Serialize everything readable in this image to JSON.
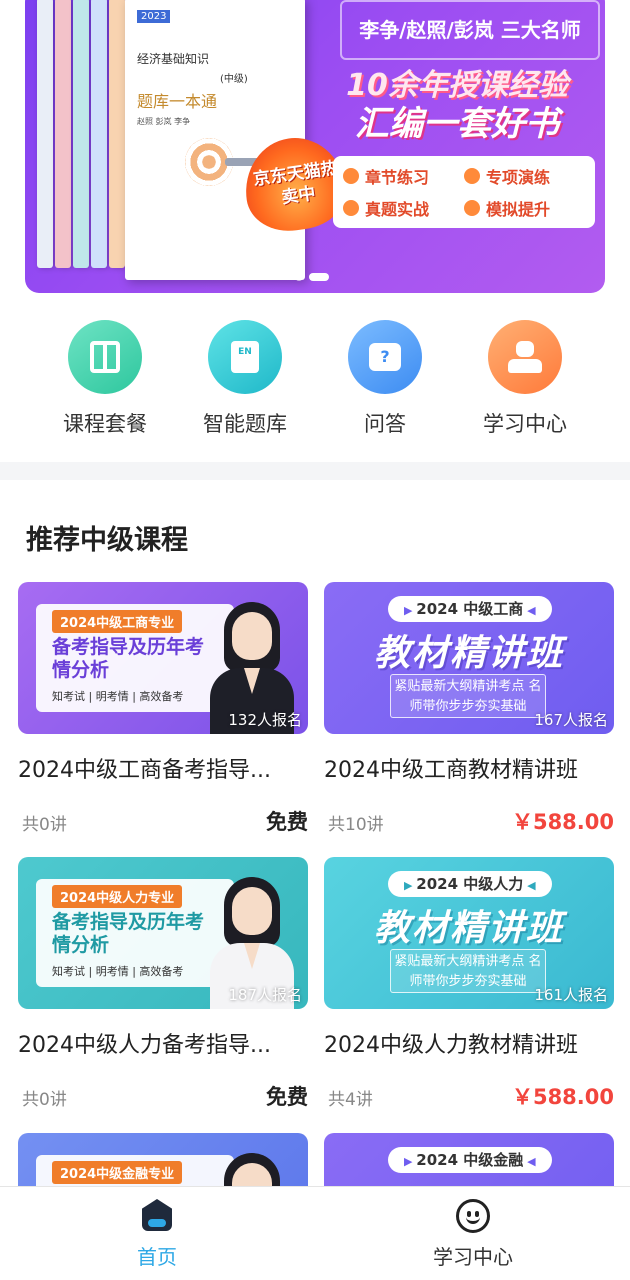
{
  "banner": {
    "book_year": "2023",
    "book_subject": "经济基础知识",
    "book_level": "(中级)",
    "book_title": "题库一本通",
    "book_authors": "赵照 彭岚 李争",
    "flame_text": "京东天猫热卖中",
    "teachers": "李争/赵照/彭岚 三大名师",
    "slogan_line1": "10余年授课经验",
    "slogan_line2": "汇编一套好书",
    "features": [
      "章节练习",
      "专项演练",
      "真题实战",
      "模拟提升"
    ],
    "slide_count": 2,
    "active_slide": 2
  },
  "quicknav": [
    {
      "label": "课程套餐",
      "icon": "book-icon"
    },
    {
      "label": "智能题库",
      "icon": "question-bank-icon"
    },
    {
      "label": "问答",
      "icon": "qa-icon"
    },
    {
      "label": "学习中心",
      "icon": "user-icon"
    }
  ],
  "qa_icon_glyph": "?",
  "question_bank_icon_glyph": "EN",
  "section_title": "推荐中级课程",
  "courses": [
    {
      "thumb_tag": "2024中级工商专业",
      "thumb_headline": "备考指导及历年考情分析",
      "thumb_tagline": "知考试 | 明考情 | 高效备考",
      "enrolled": "132人报名",
      "title": "2024中级工商备考指导...",
      "lessons": "共0讲",
      "price": "免费"
    },
    {
      "thumb_pill": "2024 中级工商",
      "thumb_bigtitle": "教材精讲班",
      "thumb_sub": "紧贴最新大纲精讲考点 名师带你步步夯实基础",
      "enrolled": "167人报名",
      "title": "2024中级工商教材精讲班",
      "lessons": "共10讲",
      "price": "￥588.00"
    },
    {
      "thumb_tag": "2024中级人力专业",
      "thumb_headline": "备考指导及历年考情分析",
      "thumb_tagline": "知考试 | 明考情 | 高效备考",
      "enrolled": "187人报名",
      "title": "2024中级人力备考指导...",
      "lessons": "共0讲",
      "price": "免费"
    },
    {
      "thumb_pill": "2024 中级人力",
      "thumb_bigtitle": "教材精讲班",
      "thumb_sub": "紧贴最新大纲精讲考点 名师带你步步夯实基础",
      "enrolled": "161人报名",
      "title": "2024中级人力教材精讲班",
      "lessons": "共4讲",
      "price": "￥588.00"
    },
    {
      "thumb_tag": "2024中级金融专业"
    },
    {
      "thumb_pill": "2024 中级金融"
    }
  ],
  "tabbar": [
    {
      "label": "首页",
      "icon": "home-icon",
      "active": true
    },
    {
      "label": "学习中心",
      "icon": "smile-icon",
      "active": false
    }
  ],
  "colors": {
    "accent": "#2ea8e6",
    "price_red": "#f2453d",
    "banner_purple": "#8a45f0"
  }
}
